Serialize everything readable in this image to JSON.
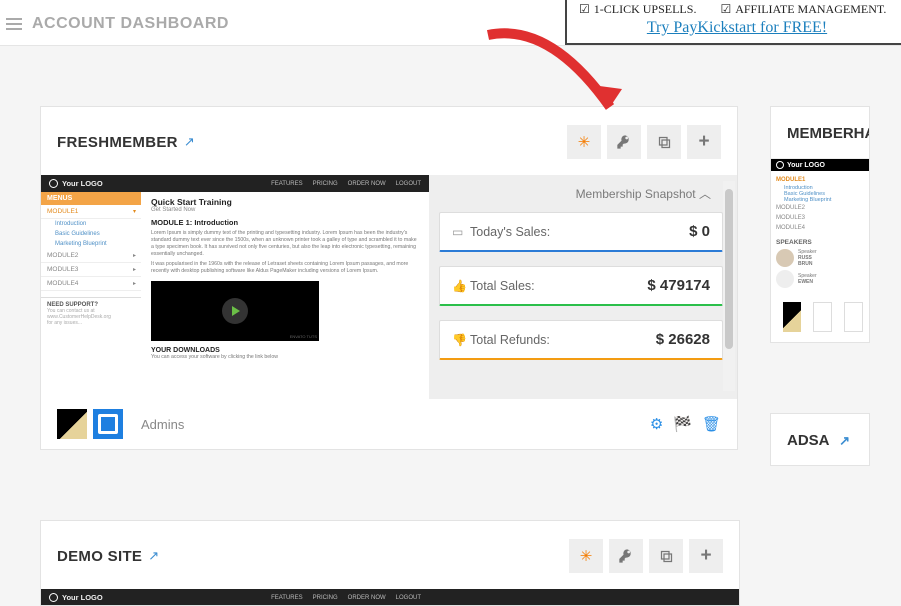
{
  "page_title": "ACCOUNT DASHBOARD",
  "promo": {
    "items": [
      "1-CLICK UPSELLS.",
      "AFFILIATE MANAGEMENT."
    ],
    "cta": "Try PayKickstart for FREE!"
  },
  "cards": {
    "freshmember": {
      "title": "FRESHMEMBER",
      "preview": {
        "logo": "Your LOGO",
        "nav": [
          "FEATURES",
          "PRICING",
          "ORDER NOW",
          "LOGOUT"
        ],
        "menus_label": "MENUS",
        "module1": "MODULE1",
        "sub1": "Introduction",
        "sub2": "Basic Guidelines",
        "sub3": "Marketing Blueprint",
        "module2": "MODULE2",
        "module3": "MODULE3",
        "module4": "MODULE4",
        "support_h": "NEED SUPPORT?",
        "support_t1": "You can contact us at",
        "support_t2": "www.CustomerHelpDesk.org",
        "support_t3": "for any issues...",
        "qs_title": "Quick Start Training",
        "qs_sub": "Get Started Now",
        "m1_h": "MODULE 1: Introduction",
        "m1_p1": "Lorem Ipsum is simply dummy text of the printing and typesetting industry. Lorem Ipsum has been the industry's standard dummy text ever since the 1500s, when an unknown printer took a galley of type and scrambled it to make a type specimen book. It has survived not only five centuries, but also the leap into electronic typesetting, remaining essentially unchanged.",
        "m1_p2": "It was popularised in the 1960s with the release of Letraset sheets containing Lorem Ipsum passages, and more recently with desktop publishing software like Aldus PageMaker including versions of Lorem Ipsum.",
        "video_brand": "ENVATO TUTS",
        "dl_h": "YOUR DOWNLOADS",
        "dl_p": "You can access your software by clicking the link below"
      },
      "snapshot": {
        "header": "Membership Snapshot",
        "todays_sales_label": "Today's Sales:",
        "todays_sales_value": "$ 0",
        "total_sales_label": "Total Sales:",
        "total_sales_value": "$ 479174",
        "total_refunds_label": "Total Refunds:",
        "total_refunds_value": "$ 26628"
      },
      "admins_label": "Admins"
    },
    "demosite": {
      "title": "DEMO SITE",
      "preview_logo": "Your LOGO",
      "nav": [
        "FEATURES",
        "PRICING",
        "ORDER NOW",
        "LOGOUT"
      ]
    },
    "memberhack": {
      "title": "MEMBERHACK",
      "preview": {
        "logo": "Your LOGO",
        "module1": "MODULE1",
        "sub1": "Introduction",
        "sub2": "Basic Guidelines",
        "sub3": "Marketing Blueprint",
        "module2": "MODULE2",
        "module3": "MODULE3",
        "module4": "MODULE4",
        "speakers_h": "SPEAKERS",
        "sp1a": "Speaker",
        "sp1b": "RUSS",
        "sp1c": "BRUN",
        "sp2a": "Speaker",
        "sp2b": "EWEN"
      }
    },
    "adsa": {
      "title": "ADSA"
    }
  }
}
